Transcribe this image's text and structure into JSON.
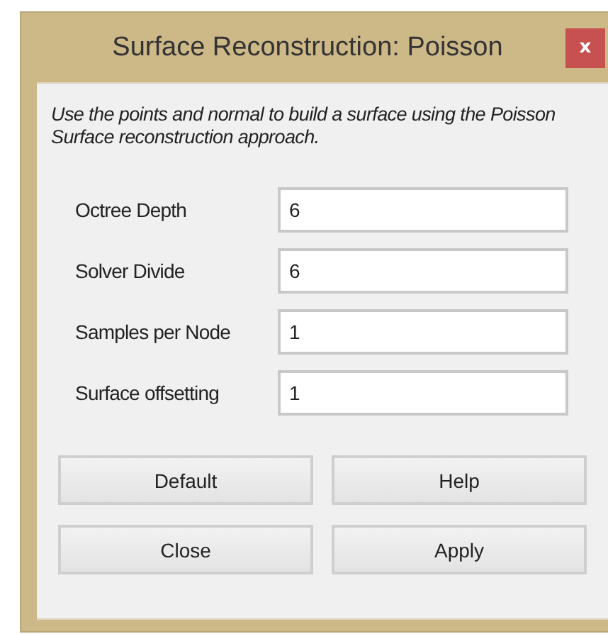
{
  "window": {
    "title": "Surface Reconstruction: Poisson",
    "close": "x"
  },
  "description": "Use the points and normal to build a surface using the Poisson Surface reconstruction approach.",
  "fields": [
    {
      "label": "Octree Depth",
      "value": "6"
    },
    {
      "label": "Solver Divide",
      "value": "6"
    },
    {
      "label": "Samples per Node",
      "value": "1"
    },
    {
      "label": "Surface offsetting",
      "value": "1"
    }
  ],
  "buttons": [
    "Default",
    "Help",
    "Close",
    "Apply"
  ]
}
